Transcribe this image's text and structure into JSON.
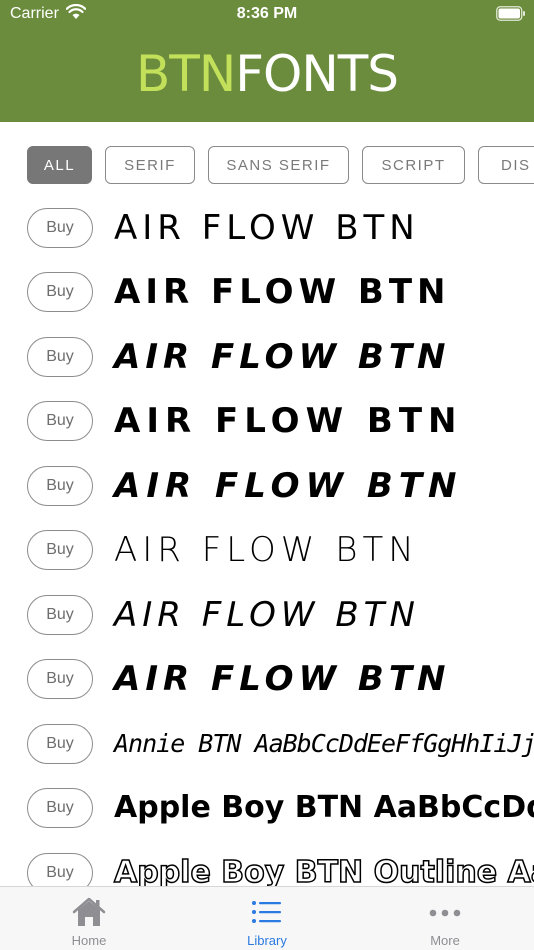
{
  "status_bar": {
    "carrier": "Carrier",
    "time": "8:36 PM"
  },
  "header": {
    "logo_part1": "BTN",
    "logo_part2": "FONTS"
  },
  "filters": [
    {
      "label": "ALL",
      "active": true
    },
    {
      "label": "SERIF",
      "active": false
    },
    {
      "label": "SANS SERIF",
      "active": false
    },
    {
      "label": "SCRIPT",
      "active": false
    },
    {
      "label": "DIS",
      "active": false
    }
  ],
  "fonts": [
    {
      "buy_label": "Buy",
      "sample": "Air Flow BTN"
    },
    {
      "buy_label": "Buy",
      "sample": "Air Flow BTN"
    },
    {
      "buy_label": "Buy",
      "sample": "Air Flow BTN"
    },
    {
      "buy_label": "Buy",
      "sample": "Air Flow BTN"
    },
    {
      "buy_label": "Buy",
      "sample": "Air Flow BTN"
    },
    {
      "buy_label": "Buy",
      "sample": "Air Flow BTN"
    },
    {
      "buy_label": "Buy",
      "sample": "Air Flow BTN"
    },
    {
      "buy_label": "Buy",
      "sample": "Air Flow BTN"
    },
    {
      "buy_label": "Buy",
      "sample": "Annie BTN AaBbCcDdEeFfGgHhIiJjKkLlMmNn"
    },
    {
      "buy_label": "Buy",
      "sample": "Apple Boy BTN AaBbCcDdEe"
    },
    {
      "buy_label": "Buy",
      "sample": "Apple Boy BTN Outline Aa"
    }
  ],
  "tabs": [
    {
      "label": "Home",
      "icon": "house-icon",
      "selected": false
    },
    {
      "label": "Library",
      "icon": "list-icon",
      "selected": true
    },
    {
      "label": "More",
      "icon": "more-dots-icon",
      "selected": false
    }
  ],
  "colors": {
    "brand_green": "#6b8c3c",
    "logo_accent": "#c3e05a",
    "tab_selected": "#2a7ae2",
    "tab_unselected": "#8e8e93"
  }
}
